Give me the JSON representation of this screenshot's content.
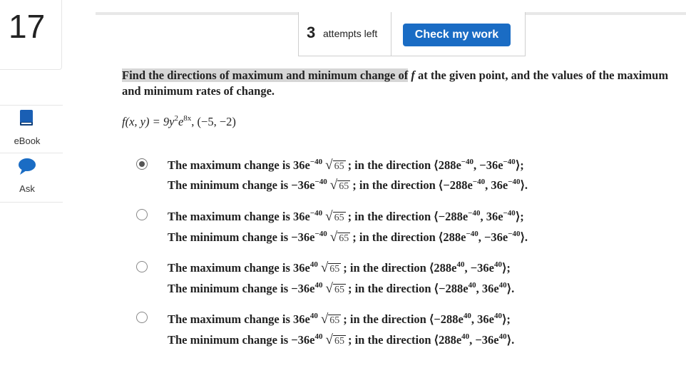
{
  "question_number": "17",
  "sidebar": {
    "ebook_label": "eBook",
    "ask_label": "Ask"
  },
  "header": {
    "attempts_count": "3",
    "attempts_text": "attempts left",
    "check_button": "Check my work",
    "check_button_color": "#1a6cc4"
  },
  "prompt": {
    "highlighted": "Find the directions of maximum and minimum change of",
    "f": "f",
    "rest": " at the given point, and the values of the maximum and minimum rates of change."
  },
  "function_text": {
    "lhs": "f(x, y) = 9y",
    "y_exp": "2",
    "e": "e",
    "e_exp": "8x",
    "point": ", (−5, −2)"
  },
  "options": [
    {
      "selected": true,
      "max": {
        "coef": "36e",
        "coef_exp": "−40",
        "root": "65",
        "dir_open": "; in the direction ⟨288e",
        "d1_exp": "−40",
        "mid": ", −36e",
        "d2_exp": "−40",
        "dir_close": "⟩;"
      },
      "min": {
        "coef": "−36e",
        "coef_exp": "−40",
        "root": "65",
        "dir_open": "; in the direction ⟨−288e",
        "d1_exp": "−40",
        "mid": ", 36e",
        "d2_exp": "−40",
        "dir_close": "⟩."
      }
    },
    {
      "selected": false,
      "max": {
        "coef": "36e",
        "coef_exp": "−40",
        "root": "65",
        "dir_open": "; in the direction ⟨−288e",
        "d1_exp": "−40",
        "mid": ", 36e",
        "d2_exp": "−40",
        "dir_close": "⟩;"
      },
      "min": {
        "coef": "−36e",
        "coef_exp": "−40",
        "root": "65",
        "dir_open": "; in the direction ⟨288e",
        "d1_exp": "−40",
        "mid": ", −36e",
        "d2_exp": "−40",
        "dir_close": "⟩."
      }
    },
    {
      "selected": false,
      "max": {
        "coef": "36e",
        "coef_exp": "40",
        "root": "65",
        "dir_open": "; in the direction ⟨288e",
        "d1_exp": "40",
        "mid": ", −36e",
        "d2_exp": "40",
        "dir_close": "⟩;"
      },
      "min": {
        "coef": "−36e",
        "coef_exp": "40",
        "root": "65",
        "dir_open": "; in the direction ⟨−288e",
        "d1_exp": "40",
        "mid": ", 36e",
        "d2_exp": "40",
        "dir_close": "⟩."
      }
    },
    {
      "selected": false,
      "max": {
        "coef": "36e",
        "coef_exp": "40",
        "root": "65",
        "dir_open": "; in the direction ⟨−288e",
        "d1_exp": "40",
        "mid": ", 36e",
        "d2_exp": "40",
        "dir_close": "⟩;"
      },
      "min": {
        "coef": "−36e",
        "coef_exp": "40",
        "root": "65",
        "dir_open": "; in the direction ⟨288e",
        "d1_exp": "40",
        "mid": ", −36e",
        "d2_exp": "40",
        "dir_close": "⟩."
      }
    }
  ],
  "line_prefix_max": "The maximum change is ",
  "line_prefix_min": "The minimum change is "
}
